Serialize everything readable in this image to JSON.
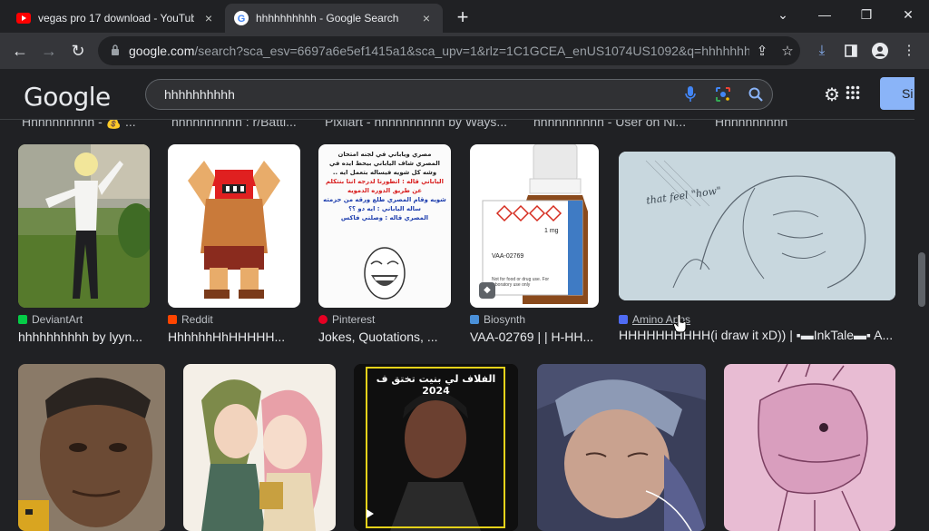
{
  "tabs": [
    {
      "title": "vegas pro 17 download - YouTube",
      "close": "×"
    },
    {
      "title": "hhhhhhhhhh - Google Search",
      "close": "×"
    }
  ],
  "new_tab": "+",
  "window": {
    "minimize": "—",
    "restore": "❐",
    "close": "✕",
    "dropdown": "⌄"
  },
  "omnibox": {
    "domain": "google.com",
    "path": "/search?sca_esv=6697a6e5ef1415a1&sca_upv=1&rlz=1C1GCEA_enUS1074US1092&q=hhhhhhhhhh"
  },
  "search": {
    "query": "hhhhhhhhhh",
    "logo": "Google",
    "signin": "Si"
  },
  "cut_row": [
    "Hhhhhhhhhh - 💰 ...",
    "hhhhhhhhhh : r/Battl...",
    "Pixilart - hhhhhhhhhh by Ways...",
    "hhhhhhhhhh - User on Ni...",
    "Hhhhhhhhhh"
  ],
  "row1": [
    {
      "source": "DeviantArt",
      "title": "hhhhhhhhhh by lyyn...",
      "icon_color": "#05cc47"
    },
    {
      "source": "Reddit",
      "title": "HhhhhhHhHHHHH...",
      "icon_color": "#ff4500"
    },
    {
      "source": "Pinterest",
      "title": "Jokes, Quotations, ...",
      "icon_color": "#e60023"
    },
    {
      "source": "Biosynth",
      "title": "VAA-02769 | | H-HH...",
      "icon_color": "#4a90d9"
    },
    {
      "source": "Amino Apps",
      "title": "HHHHHHHHHH(i draw it xD)) | ▪▬InkTale▬▪ A...",
      "icon_color": "#4f6bf4"
    }
  ],
  "meme": {
    "lines": [
      "مصري وياباني في لجنه امتحان",
      "المصري شاف الياباني بيحط ايده في",
      "وشه كل شويه فيساله بتعمل ايه ..",
      "الياباني قاله : اتطورنا لدرجه اننا بنتكلم",
      "عن طريق الدوره الدمويه",
      "شويه وقام المصري طلع ورقه من جزمته",
      "ساله الياباني : ايه دو ؟؟",
      "المصري قاله : وصلني فاكس"
    ]
  },
  "vial": {
    "code": "VAA-02769",
    "dose": "1 mg",
    "note": "Not for food or drug use. For laboratory use only"
  },
  "sketch_text": "that feel \"how\"",
  "video_caption": "الفلاف لي بنيت تختق ف 2024"
}
